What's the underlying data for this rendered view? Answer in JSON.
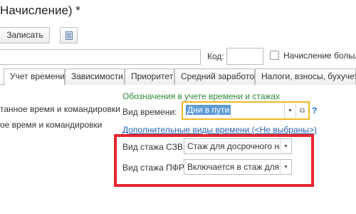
{
  "header": {
    "title": "Начисление) *"
  },
  "toolbar": {
    "save_label": "Записать",
    "list_icon": "list-icon"
  },
  "form": {
    "code_label": "Код:",
    "name_value": "",
    "code_value": "",
    "checkbox_label": "Начисление больше"
  },
  "tabs": [
    {
      "label": "Учет времени",
      "active": true
    },
    {
      "label": "Зависимости",
      "active": false
    },
    {
      "label": "Приоритет",
      "active": false
    },
    {
      "label": "Средний заработок",
      "active": false
    },
    {
      "label": "Налоги, взносы, бухучет",
      "active": false
    }
  ],
  "left_list": [
    "танное время и командировки",
    "ое время и командировки"
  ],
  "time_section": {
    "title": "Обозначения в учете времени и стажах",
    "vid_vremeni_label": "Вид времени:",
    "vid_vremeni_value": "Дни в пути",
    "help": "?",
    "additional_link": "Дополнительные виды времени (<Не выбраны>)",
    "szv_label": "Вид стажа СЗВ:",
    "szv_value": "Стаж для досрочного наз",
    "pfr_label": "Вид стажа ПФР:",
    "pfr_value": "Включается в стаж для д"
  },
  "colors": {
    "highlight_box": "#e8272f",
    "focus_border": "#f2b822",
    "section_title": "#2e8b3a",
    "link": "#2060b5"
  }
}
